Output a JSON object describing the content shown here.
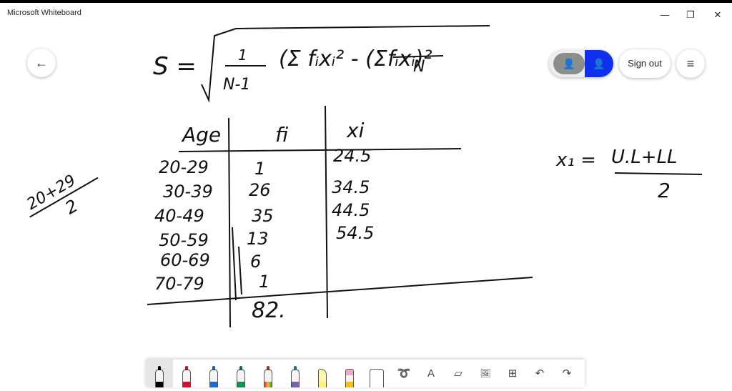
{
  "window": {
    "title": "Microsoft Whiteboard",
    "minimize": "—",
    "restore": "❐",
    "close": "✕"
  },
  "nav": {
    "back_icon": "arrow-left-icon",
    "back": "←"
  },
  "header": {
    "sign_out": "Sign out",
    "menu": "≡",
    "user_icon": "person-icon"
  },
  "accent": "#1030f0",
  "board": {
    "formula": {
      "lhs": "S =",
      "fraction_num": "1",
      "fraction_den": "N-1",
      "bracket": "(Σ fᵢxᵢ² - (Σfᵢxᵢ)²",
      "den_N": "N"
    },
    "table": {
      "headers": [
        "Age",
        "fi",
        "xi"
      ],
      "ages": [
        "20-29",
        "30-39",
        "40-49",
        "50-59",
        "60-69",
        "70-79"
      ],
      "fi": [
        "1",
        "26",
        "35",
        "13",
        "6",
        "1"
      ],
      "xi": [
        "24.5",
        "34.5",
        "44.5",
        "54.5"
      ],
      "total": "82."
    },
    "side_note_left": {
      "num": "20+29",
      "den": "2"
    },
    "side_note_right": {
      "lhs": "x₁ =",
      "num": "U.L+LL",
      "den": "2"
    }
  },
  "toolbar": {
    "tools": [
      "Black pen",
      "Red pen",
      "Blue pen",
      "Green pen",
      "Rainbow pen",
      "Galaxy pen",
      "Highlighter",
      "Eraser",
      "Ruler",
      "Lasso",
      "Text",
      "Note",
      "Image",
      "Insert",
      "Undo",
      "Redo"
    ],
    "glyphs": {
      "text": "A",
      "note": "▱",
      "image": "🖼",
      "insert": "⊞",
      "undo": "↶",
      "redo": "↷"
    }
  }
}
